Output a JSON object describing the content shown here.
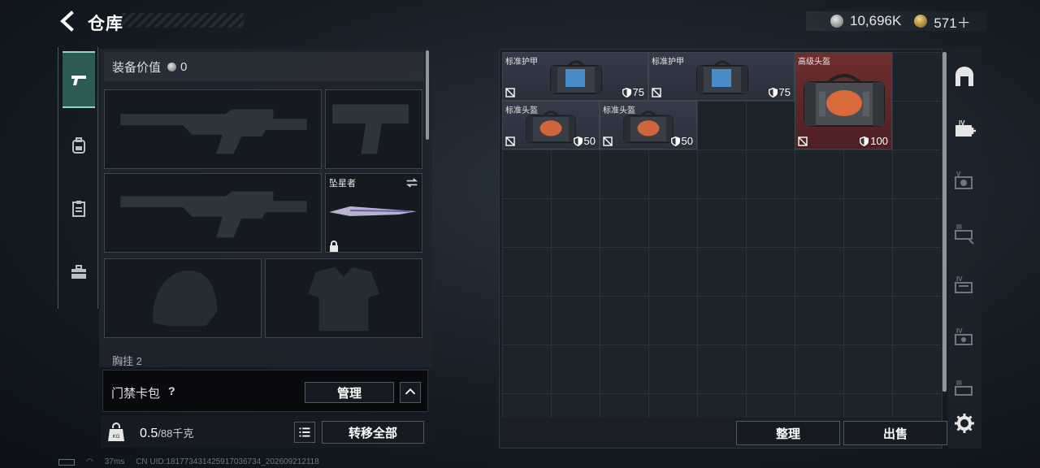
{
  "header": {
    "title": "仓库",
    "currency_silver": "10,696K",
    "currency_gold": "571＋"
  },
  "tabs": [
    {
      "name": "weapon",
      "icon": "pistol-icon",
      "active": true
    },
    {
      "name": "backpack",
      "icon": "backpack-icon",
      "active": false
    },
    {
      "name": "clipboard",
      "icon": "clipboard-icon",
      "active": false
    },
    {
      "name": "case",
      "icon": "briefcase-icon",
      "active": false
    }
  ],
  "equipment": {
    "value_label": "装备价值",
    "value": "0",
    "melee_name": "坠星者",
    "chest_label": "胸挂 2"
  },
  "keycard": {
    "label": "门禁卡包",
    "help": "?",
    "manage_label": "管理"
  },
  "weight": {
    "current": "0.5",
    "max_text": "/88千克",
    "transfer_all_label": "转移全部"
  },
  "storage": {
    "items": [
      {
        "name": "标准护甲",
        "durability": "75",
        "kind": "armor"
      },
      {
        "name": "标准护甲",
        "durability": "75",
        "kind": "armor"
      },
      {
        "name": "高级头盔",
        "durability": "100",
        "kind": "helmet-premium"
      },
      {
        "name": "标准头盔",
        "durability": "50",
        "kind": "helmet"
      },
      {
        "name": "标准头盔",
        "durability": "50",
        "kind": "helmet"
      }
    ],
    "organize_label": "整理",
    "sell_label": "出售"
  },
  "status": {
    "ping": "37ms",
    "uid": "CN UID:18177343142591703673​4_202609212118"
  },
  "colors": {
    "accent": "#8fd9c4",
    "premium": "#6e2e2e"
  }
}
